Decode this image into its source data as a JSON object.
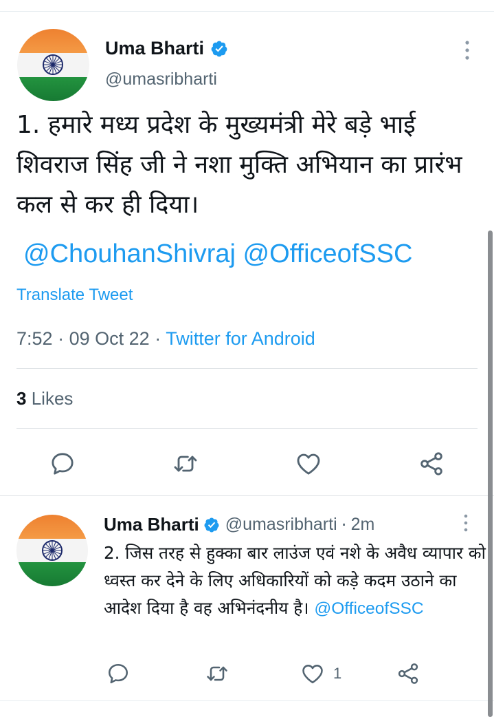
{
  "main_tweet": {
    "author_name": "Uma Bharti",
    "handle": "@umasribharti",
    "text": "1. हमारे मध्य प्रदेश के मुख्यमंत्री मेरे बड़े भाई शिवराज सिंह जी ने नशा मुक्ति अभियान का प्रारंभ कल से कर ही दिया।",
    "mentions": "@ChouhanShivraj @OfficeofSSC",
    "translate_label": "Translate Tweet",
    "time": "7:52",
    "date": "09 Oct 22",
    "separator": "·",
    "source": "Twitter for Android",
    "likes_count": "3",
    "likes_label": "Likes"
  },
  "reply_tweet": {
    "author_name": "Uma Bharti",
    "handle": "@umasribharti",
    "separator": "·",
    "time_ago": "2m",
    "text": "2. जिस तरह से हुक्का बार लाउंज एवं नशे के अवैध व्यापार को ध्वस्त कर देने के लिए अधिकारियों को कड़े कदम उठाने का आदेश दिया है वह अभिनंदनीय है।",
    "mention": "@OfficeofSSC",
    "like_count": "1"
  },
  "icons": [
    "verified-badge-icon",
    "more-options-icon",
    "reply-icon",
    "retweet-icon",
    "like-icon",
    "share-icon"
  ],
  "colors": {
    "accent": "#1d9bf0",
    "secondary_text": "#536471",
    "primary_text": "#0f1419",
    "divider": "#dfe3e6",
    "flag_saffron": "#f08a2c",
    "flag_white": "#f4f4f4",
    "flag_green": "#1f8a3a",
    "chakra_navy": "#1d2a6b"
  }
}
